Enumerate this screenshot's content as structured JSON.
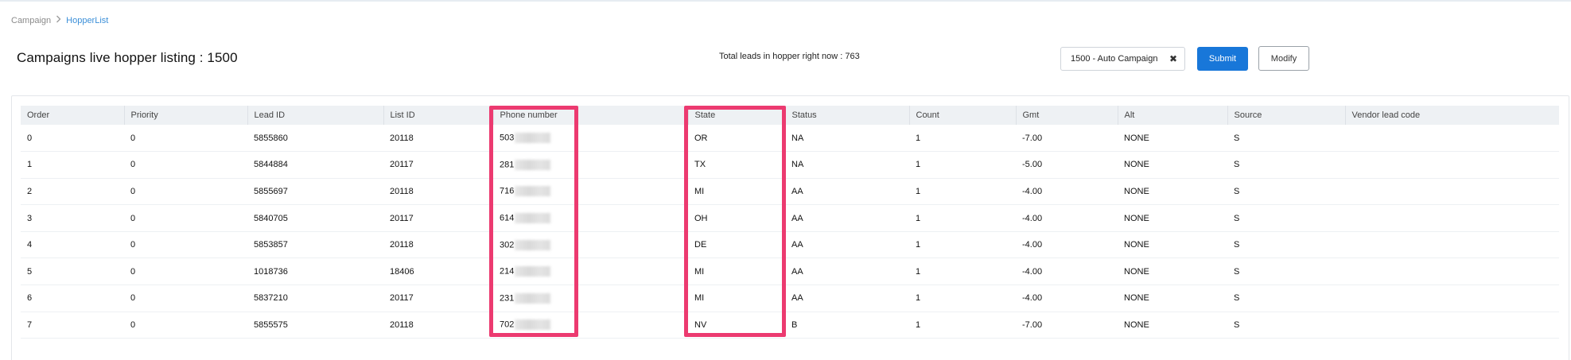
{
  "breadcrumb": {
    "parent": "Campaign",
    "current": "HopperList"
  },
  "page_title": "Campaigns live hopper listing : 1500",
  "total_leads_text": "Total leads in hopper right now : 763",
  "campaign_select": {
    "value": "1500 - Auto Campaign",
    "clear_symbol": "✖"
  },
  "buttons": {
    "submit": "Submit",
    "modify": "Modify"
  },
  "table": {
    "columns": [
      "Order",
      "Priority",
      "Lead ID",
      "List ID",
      "Phone number",
      "State",
      "Status",
      "Count",
      "Gmt",
      "Alt",
      "Source",
      "Vendor lead code"
    ],
    "rows": [
      {
        "order": "0",
        "priority": "0",
        "lead_id": "5855860",
        "list_id": "20118",
        "phone": "503",
        "state": "OR",
        "status": "NA",
        "count": "1",
        "gmt": "-7.00",
        "alt": "NONE",
        "source": "S",
        "vendor": ""
      },
      {
        "order": "1",
        "priority": "0",
        "lead_id": "5844884",
        "list_id": "20117",
        "phone": "281",
        "state": "TX",
        "status": "NA",
        "count": "1",
        "gmt": "-5.00",
        "alt": "NONE",
        "source": "S",
        "vendor": ""
      },
      {
        "order": "2",
        "priority": "0",
        "lead_id": "5855697",
        "list_id": "20118",
        "phone": "716",
        "state": "MI",
        "status": "AA",
        "count": "1",
        "gmt": "-4.00",
        "alt": "NONE",
        "source": "S",
        "vendor": ""
      },
      {
        "order": "3",
        "priority": "0",
        "lead_id": "5840705",
        "list_id": "20117",
        "phone": "614",
        "state": "OH",
        "status": "AA",
        "count": "1",
        "gmt": "-4.00",
        "alt": "NONE",
        "source": "S",
        "vendor": ""
      },
      {
        "order": "4",
        "priority": "0",
        "lead_id": "5853857",
        "list_id": "20118",
        "phone": "302",
        "state": "DE",
        "status": "AA",
        "count": "1",
        "gmt": "-4.00",
        "alt": "NONE",
        "source": "S",
        "vendor": ""
      },
      {
        "order": "5",
        "priority": "0",
        "lead_id": "1018736",
        "list_id": "18406",
        "phone": "214",
        "state": "MI",
        "status": "AA",
        "count": "1",
        "gmt": "-4.00",
        "alt": "NONE",
        "source": "S",
        "vendor": ""
      },
      {
        "order": "6",
        "priority": "0",
        "lead_id": "5837210",
        "list_id": "20117",
        "phone": "231",
        "state": "MI",
        "status": "AA",
        "count": "1",
        "gmt": "-4.00",
        "alt": "NONE",
        "source": "S",
        "vendor": ""
      },
      {
        "order": "7",
        "priority": "0",
        "lead_id": "5855575",
        "list_id": "20118",
        "phone": "702",
        "state": "NV",
        "status": "B",
        "count": "1",
        "gmt": "-7.00",
        "alt": "NONE",
        "source": "S",
        "vendor": ""
      }
    ]
  },
  "colors": {
    "accent": "#1877d9",
    "highlight": "#ec3a70",
    "breadcrumb_current": "#3b8fd8",
    "header_bg": "#eef1f4"
  },
  "icons": {
    "breadcrumb_separator": "chevron-right-icon",
    "clear": "close-icon"
  }
}
